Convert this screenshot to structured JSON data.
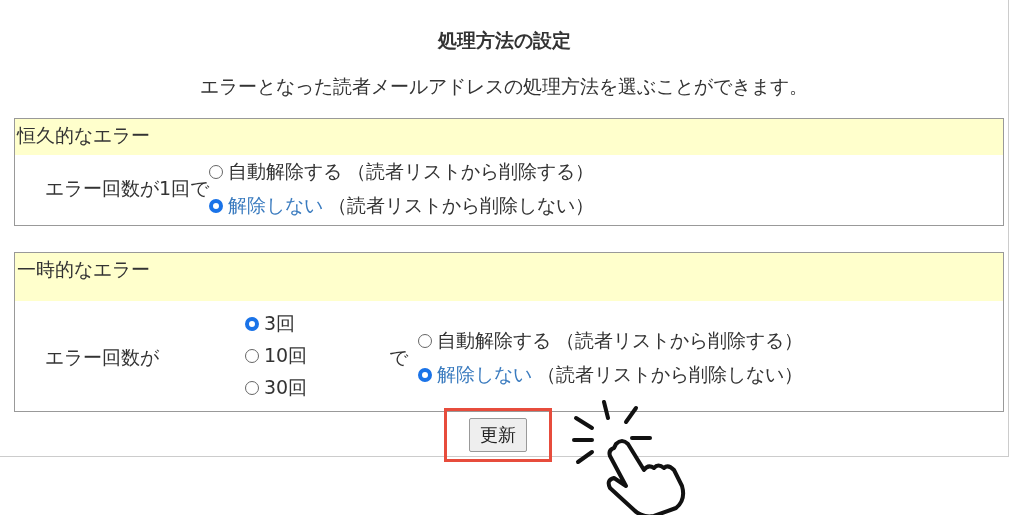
{
  "title": "処理方法の設定",
  "description": "エラーとなった読者メールアドレスの処理方法を選ぶことができます。",
  "sections": [
    {
      "title": "恒久的なエラー",
      "kind": "single",
      "prefix": "エラー回数が1回で",
      "options": [
        {
          "label": "自動解除する",
          "note": "（読者リストから削除する）",
          "selected": false
        },
        {
          "label": "解除しない",
          "note": "（読者リストから削除しない）",
          "selected": true
        }
      ]
    },
    {
      "title": "一時的なエラー",
      "kind": "count",
      "prefix": "エラー回数が",
      "counts": [
        {
          "label": "3回",
          "selected": true
        },
        {
          "label": "10回",
          "selected": false
        },
        {
          "label": "30回",
          "selected": false
        }
      ],
      "joiner": "で",
      "options": [
        {
          "label": "自動解除する",
          "note": "（読者リストから削除する）",
          "selected": false
        },
        {
          "label": "解除しない",
          "note": "（読者リストから削除しない）",
          "selected": true
        }
      ]
    }
  ],
  "button": {
    "label": "更新",
    "highlighted": true
  }
}
